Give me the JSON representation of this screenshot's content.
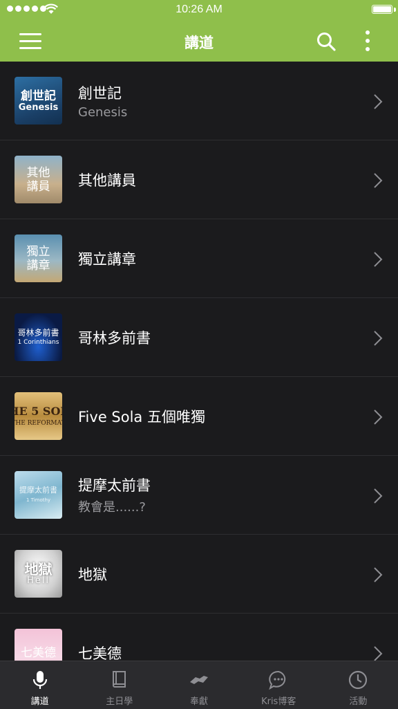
{
  "status_bar": {
    "time": "10:26 AM"
  },
  "nav": {
    "title": "講道"
  },
  "items": [
    {
      "title": "創世記",
      "subtitle": "Genesis",
      "thumb_line1": "創世記",
      "thumb_line2": "Genesis"
    },
    {
      "title": "其他講員",
      "subtitle": "",
      "thumb_line1": "其他",
      "thumb_line2": "講員"
    },
    {
      "title": "獨立講章",
      "subtitle": "",
      "thumb_line1": "獨立",
      "thumb_line2": "講章"
    },
    {
      "title": "哥林多前書",
      "subtitle": "",
      "thumb_line1": "哥林多前書",
      "thumb_line2": "1 Corinthians"
    },
    {
      "title": "Five Sola 五個唯獨",
      "subtitle": "",
      "thumb_line1": "HE 5 SOL",
      "thumb_line2": "THE REFORMAT"
    },
    {
      "title": "提摩太前書",
      "subtitle": "教會是......?",
      "thumb_line1": "提摩太前書",
      "thumb_line2": "1 Timothy"
    },
    {
      "title": "地獄",
      "subtitle": "",
      "thumb_line1": "地獄",
      "thumb_line2": "Hell"
    },
    {
      "title": "七美德",
      "subtitle": "",
      "thumb_line1": "七美德",
      "thumb_line2": ""
    }
  ],
  "tabs": [
    {
      "label": "講道",
      "icon": "microphone-icon",
      "active": true
    },
    {
      "label": "主日學",
      "icon": "book-icon",
      "active": false
    },
    {
      "label": "奉獻",
      "icon": "handshake-icon",
      "active": false
    },
    {
      "label": "Kris博客",
      "icon": "chat-bubble-icon",
      "active": false
    },
    {
      "label": "活動",
      "icon": "clock-icon",
      "active": false
    }
  ],
  "colors": {
    "header": "#8fbf4b",
    "background": "#1b1b1d",
    "tabbar": "#2b2b2e"
  }
}
